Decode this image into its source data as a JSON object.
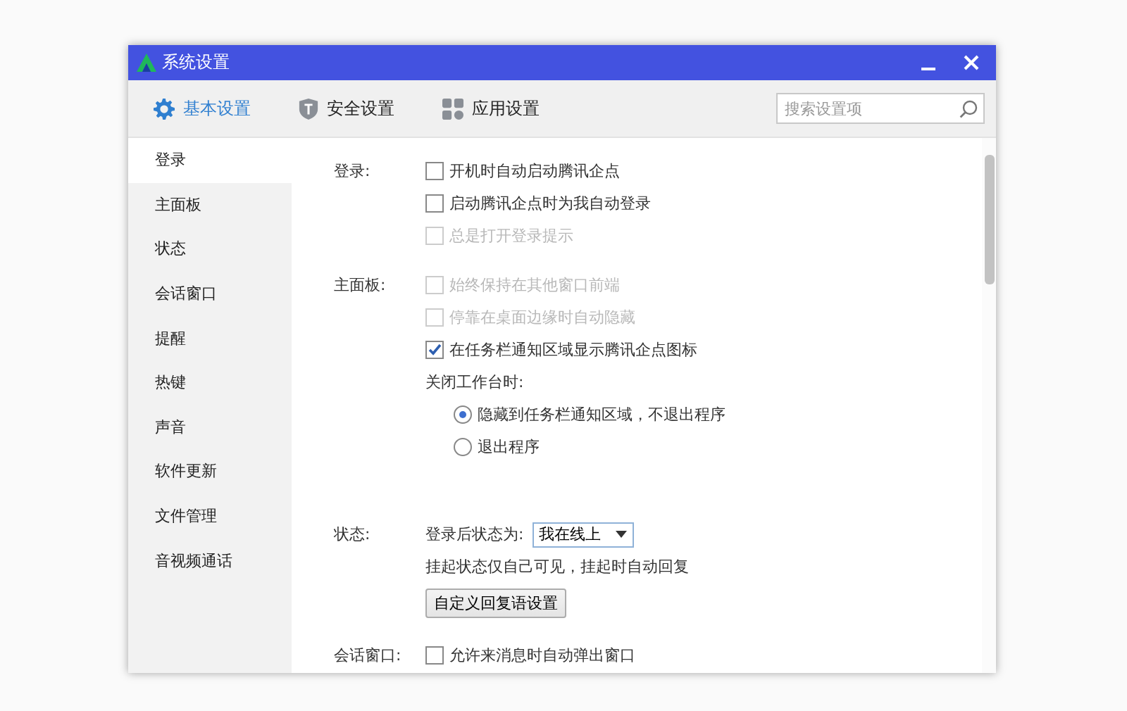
{
  "window": {
    "title": "系统设置"
  },
  "tabs": [
    {
      "label": "基本设置",
      "selected": true,
      "kind": "gear"
    },
    {
      "label": "安全设置",
      "selected": false,
      "kind": "shield"
    },
    {
      "label": "应用设置",
      "selected": false,
      "kind": "apps"
    }
  ],
  "search": {
    "placeholder": "搜索设置项"
  },
  "sidebar": {
    "items": [
      {
        "label": "登录",
        "selected": true
      },
      {
        "label": "主面板",
        "selected": false
      },
      {
        "label": "状态",
        "selected": false
      },
      {
        "label": "会话窗口",
        "selected": false
      },
      {
        "label": "提醒",
        "selected": false
      },
      {
        "label": "热键",
        "selected": false
      },
      {
        "label": "声音",
        "selected": false
      },
      {
        "label": "软件更新",
        "selected": false
      },
      {
        "label": "文件管理",
        "selected": false
      },
      {
        "label": "音视频通话",
        "selected": false
      }
    ]
  },
  "sections": [
    {
      "label": "登录:",
      "items": [
        {
          "kind": "checkbox",
          "label": "开机时自动启动腾讯企点",
          "checked": false,
          "disabled": false
        },
        {
          "kind": "checkbox",
          "label": "启动腾讯企点时为我自动登录",
          "checked": false,
          "disabled": false
        },
        {
          "kind": "checkbox",
          "label": "总是打开登录提示",
          "checked": false,
          "disabled": true
        }
      ]
    },
    {
      "label": "主面板:",
      "items": [
        {
          "kind": "checkbox",
          "label": "始终保持在其他窗口前端",
          "checked": false,
          "disabled": true
        },
        {
          "kind": "checkbox",
          "label": "停靠在桌面边缘时自动隐藏",
          "checked": false,
          "disabled": true
        },
        {
          "kind": "checkbox",
          "label": "在任务栏通知区域显示腾讯企点图标",
          "checked": true,
          "disabled": false
        },
        {
          "kind": "text",
          "label": "关闭工作台时:"
        },
        {
          "kind": "radio",
          "label": "隐藏到任务栏通知区域，不退出程序",
          "selected": true
        },
        {
          "kind": "radio",
          "label": "退出程序",
          "selected": false
        }
      ]
    },
    {
      "label": "状态:",
      "items": [
        {
          "kind": "select",
          "label": "登录后状态为:",
          "value": "我在线上"
        },
        {
          "kind": "text",
          "label": "挂起状态仅自己可见，挂起时自动回复"
        },
        {
          "kind": "button",
          "label": "自定义回复语设置"
        }
      ]
    },
    {
      "label": "会话窗口:",
      "items": [
        {
          "kind": "checkbox",
          "label": "允许来消息时自动弹出窗口",
          "checked": false,
          "disabled": false
        }
      ]
    }
  ]
}
